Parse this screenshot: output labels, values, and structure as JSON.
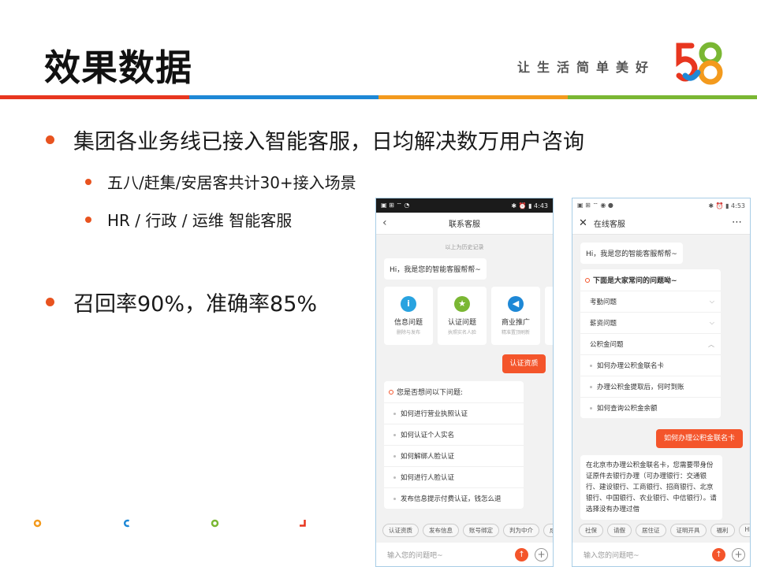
{
  "slide": {
    "title": "效果数据",
    "tagline": "让生活简单美好",
    "logo_text": "58",
    "stripe_colors": [
      "#e8361f",
      "#1e88d6",
      "#f39a1d",
      "#7ab733"
    ]
  },
  "bullets": [
    {
      "text": "集团各业务线已接入智能客服，日均解决数万用户咨询"
    },
    {
      "text": "五八/赶集/安居客共计30+接入场景"
    },
    {
      "text": "HR / 行政 / 运维 智能客服"
    },
    {
      "text": "召回率90%，准确率85%"
    }
  ],
  "phone1": {
    "status_time": "4:43",
    "nav_title": "联系客服",
    "history_label": "以上为历史记录",
    "greeting": "Hi，我是您的智能客服帮帮~",
    "cards": [
      {
        "label": "信息问题",
        "sub": "删除与发布",
        "icon": "info-icon",
        "glyph": "i",
        "color": "#29a3e0"
      },
      {
        "label": "认证问题",
        "sub": "执照实名人脸",
        "icon": "star-icon",
        "glyph": "★",
        "color": "#7ab733"
      },
      {
        "label": "商业推广",
        "sub": "精准置顶刷新",
        "icon": "megaphone-icon",
        "glyph": "◀",
        "color": "#1e88d6"
      }
    ],
    "user_message": "认证资质",
    "question_header": "您是否想问以下问题:",
    "questions": [
      "如何进行营业执照认证",
      "如何认证个人实名",
      "如何解绑人脸认证",
      "如何进行人脸认证",
      "发布信息提示付费认证，钱怎么退"
    ],
    "chips": [
      "认证资质",
      "发布信息",
      "账号绑定",
      "判为中介",
      "成"
    ],
    "input_placeholder": "输入您的问题吧~"
  },
  "phone2": {
    "status_time": "4:53",
    "nav_title": "在线客服",
    "greeting": "Hi，我是您的智能客服帮帮~",
    "faq_header": "下面是大家常问的问题呦~",
    "categories": [
      {
        "label": "考勤问题",
        "chev": "⌵"
      },
      {
        "label": "薪资问题",
        "chev": "⌵"
      },
      {
        "label": "公积金问题",
        "chev": "︿"
      }
    ],
    "sub_questions": [
      "如何办理公积金联名卡",
      "办理公积金提取后，何时到账",
      "如何查询公积金余额"
    ],
    "user_message": "如何办理公积金联名卡",
    "answer": "在北京市办理公积金联名卡，您需要带身份证原件去银行办理（可办理银行：交通银行、建设银行、工商银行、招商银行、北京银行、中国银行、农业银行、中信银行）。请选择没有办理过借",
    "chips": [
      "社保",
      "请假",
      "居住证",
      "证明开具",
      "福利",
      "HR"
    ],
    "input_placeholder": "输入您的问题吧~"
  }
}
